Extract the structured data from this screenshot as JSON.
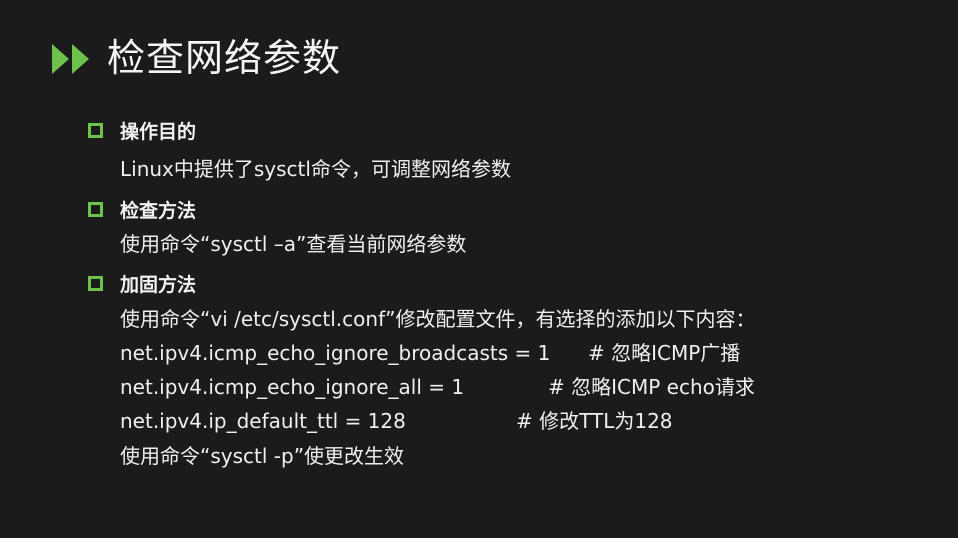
{
  "slide": {
    "title": "检查网络参数",
    "accent_color": "#6cc24a",
    "sections": [
      {
        "heading": "操作目的",
        "lines": [
          "Linux中提供了sysctl命令，可调整网络参数"
        ]
      },
      {
        "heading": "检查方法",
        "lines": [
          "使用命令“sysctl –a”查看当前网络参数"
        ]
      },
      {
        "heading": "加固方法",
        "intro": "使用命令“vi /etc/sysctl.conf”修改配置文件，有选择的添加以下内容：",
        "config": [
          {
            "setting": "net.ipv4.icmp_echo_ignore_broadcasts = 1",
            "comment": "# 忽略ICMP广播"
          },
          {
            "setting": "net.ipv4.icmp_echo_ignore_all = 1",
            "comment": "# 忽略ICMP echo请求"
          },
          {
            "setting": "net.ipv4.ip_default_ttl = 128",
            "comment": "# 修改TTL为128"
          }
        ],
        "outro": "使用命令“sysctl -p”使更改生效"
      }
    ]
  }
}
